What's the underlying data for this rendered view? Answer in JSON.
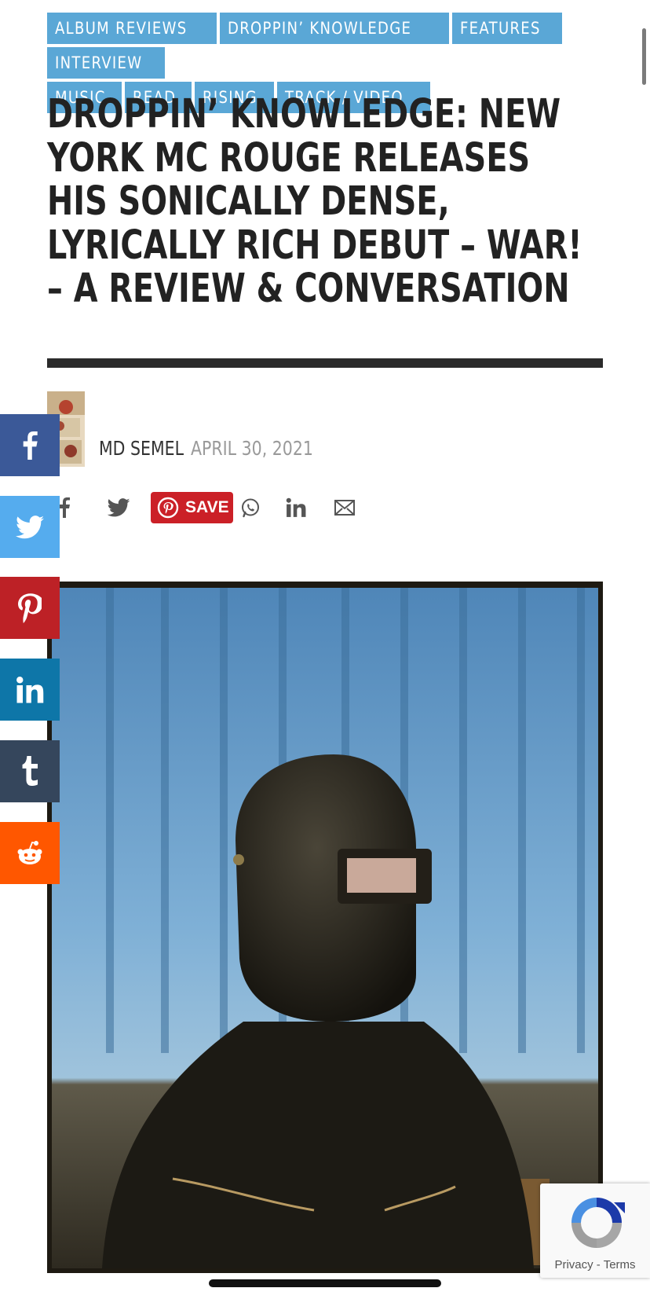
{
  "categories": [
    "ALBUM REVIEWS",
    "DROPPIN’ KNOWLEDGE",
    "FEATURES",
    "INTERVIEW",
    "MUSIC",
    "READ",
    "RISING",
    "TRACK / VIDEO"
  ],
  "headline": "DROPPIN’ KNOWLEDGE: NEW YORK MC ROUGE RELEASES HIS SONICALLY DENSE, LYRICALLY RICH DEBUT – WAR! – A REVIEW & CONVERSATION",
  "byline": {
    "author": "MD SEMEL",
    "date": "APRIL 30, 2021"
  },
  "share_row": {
    "save_label": "SAVE",
    "icons": [
      "facebook-icon",
      "twitter-icon",
      "pinterest-icon",
      "whatsapp-icon",
      "linkedin-icon",
      "email-icon"
    ]
  },
  "floating_share": [
    "facebook",
    "twitter",
    "pinterest",
    "linkedin",
    "tumblr",
    "reddit"
  ],
  "recaptcha": {
    "privacy": "Privacy",
    "separator": "-",
    "terms": "Terms"
  },
  "colors": {
    "tag_bg": "#5aa7d6",
    "headline": "#222222",
    "rule": "#2b2b2b",
    "facebook": "#3b5998",
    "twitter": "#55acee",
    "pinterest": "#bd2126",
    "linkedin": "#0e76a8",
    "tumblr": "#35465c",
    "reddit": "#ff5700",
    "save_btn": "#cb2027"
  }
}
